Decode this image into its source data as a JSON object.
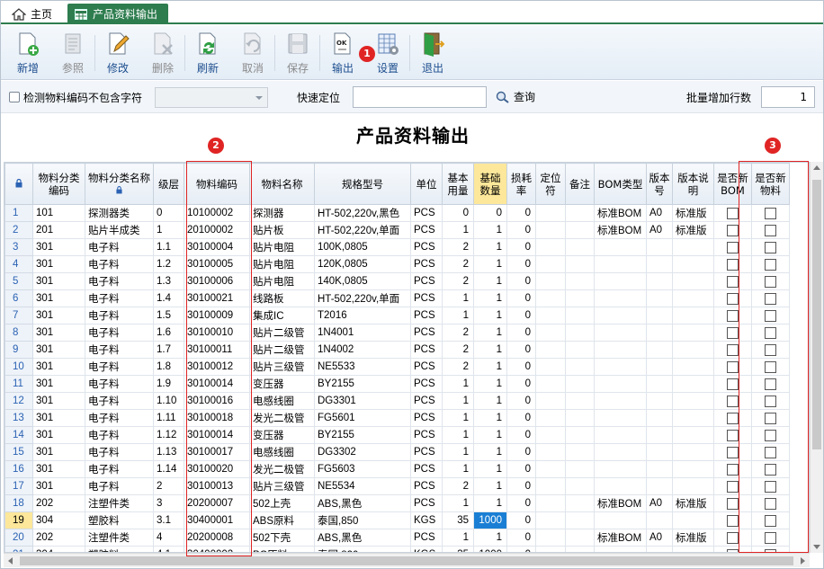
{
  "tabs": [
    {
      "label": "主页",
      "icon": "home-icon"
    },
    {
      "label": "产品资料输出",
      "icon": "table-icon"
    }
  ],
  "toolbar": {
    "buttons": [
      {
        "label": "新增",
        "icon": "new-doc-icon",
        "enabled": true
      },
      {
        "label": "参照",
        "icon": "reference-icon",
        "enabled": false
      },
      {
        "label": "修改",
        "icon": "edit-icon",
        "enabled": true
      },
      {
        "label": "删除",
        "icon": "delete-icon",
        "enabled": false
      },
      {
        "label": "刷新",
        "icon": "refresh-icon",
        "enabled": true
      },
      {
        "label": "取消",
        "icon": "cancel-icon",
        "enabled": false
      },
      {
        "label": "保存",
        "icon": "save-icon",
        "enabled": false
      },
      {
        "label": "输出",
        "icon": "export-icon",
        "enabled": true
      },
      {
        "label": "设置",
        "icon": "settings-icon",
        "enabled": true
      },
      {
        "label": "退出",
        "icon": "exit-icon",
        "enabled": true
      }
    ]
  },
  "filter": {
    "checkbox_label": "检测物料编码不包含字符",
    "quick_locate_label": "快速定位",
    "quick_locate_value": "",
    "query_label": "查询",
    "batch_rows_label": "批量增加行数",
    "batch_rows_value": "1"
  },
  "page_title": "产品资料输出",
  "annotations": [
    "1",
    "2",
    "3"
  ],
  "colors": {
    "brand_green": "#2e7d4f",
    "highlight_yellow": "#fce79a",
    "selected_blue": "#1a7fd4",
    "annotation_red": "#e02424"
  },
  "grid": {
    "columns": [
      "物料分类编码",
      "物料分类名称",
      "级层",
      "物料编码",
      "物料名称",
      "规格型号",
      "单位",
      "基本用量",
      "基础数量",
      "损耗率",
      "定位符",
      "备注",
      "BOM类型",
      "版本号",
      "版本说明",
      "是否新BOM",
      "是否新物料"
    ],
    "rows": [
      {
        "n": "1",
        "cat": "101",
        "catname": "探测器类",
        "lvl": "0",
        "code": "10100002",
        "name": "探测器",
        "spec": "HT-502,220v,黑色",
        "unit": "PCS",
        "use": "0",
        "qty": "0",
        "loss": "0",
        "bom": "标准BOM",
        "ver": "A0",
        "verdesc": "标准版"
      },
      {
        "n": "2",
        "cat": "201",
        "catname": "贴片半成类",
        "lvl": "1",
        "code": "20100002",
        "name": "贴片板",
        "spec": "HT-502,220v,单面",
        "unit": "PCS",
        "use": "1",
        "qty": "1",
        "loss": "0",
        "bom": "标准BOM",
        "ver": "A0",
        "verdesc": "标准版"
      },
      {
        "n": "3",
        "cat": "301",
        "catname": "电子料",
        "lvl": "1.1",
        "code": "30100004",
        "name": "贴片电阻",
        "spec": "100K,0805",
        "unit": "PCS",
        "use": "2",
        "qty": "1",
        "loss": "0",
        "bom": "",
        "ver": "",
        "verdesc": ""
      },
      {
        "n": "4",
        "cat": "301",
        "catname": "电子料",
        "lvl": "1.2",
        "code": "30100005",
        "name": "贴片电阻",
        "spec": "120K,0805",
        "unit": "PCS",
        "use": "2",
        "qty": "1",
        "loss": "0",
        "bom": "",
        "ver": "",
        "verdesc": ""
      },
      {
        "n": "5",
        "cat": "301",
        "catname": "电子料",
        "lvl": "1.3",
        "code": "30100006",
        "name": "贴片电阻",
        "spec": "140K,0805",
        "unit": "PCS",
        "use": "2",
        "qty": "1",
        "loss": "0",
        "bom": "",
        "ver": "",
        "verdesc": ""
      },
      {
        "n": "6",
        "cat": "301",
        "catname": "电子料",
        "lvl": "1.4",
        "code": "30100021",
        "name": "线路板",
        "spec": "HT-502,220v,单面",
        "unit": "PCS",
        "use": "1",
        "qty": "1",
        "loss": "0",
        "bom": "",
        "ver": "",
        "verdesc": ""
      },
      {
        "n": "7",
        "cat": "301",
        "catname": "电子料",
        "lvl": "1.5",
        "code": "30100009",
        "name": "集成IC",
        "spec": "T2016",
        "unit": "PCS",
        "use": "1",
        "qty": "1",
        "loss": "0",
        "bom": "",
        "ver": "",
        "verdesc": ""
      },
      {
        "n": "8",
        "cat": "301",
        "catname": "电子料",
        "lvl": "1.6",
        "code": "30100010",
        "name": "贴片二级管",
        "spec": "1N4001",
        "unit": "PCS",
        "use": "2",
        "qty": "1",
        "loss": "0",
        "bom": "",
        "ver": "",
        "verdesc": ""
      },
      {
        "n": "9",
        "cat": "301",
        "catname": "电子料",
        "lvl": "1.7",
        "code": "30100011",
        "name": "贴片二级管",
        "spec": "1N4002",
        "unit": "PCS",
        "use": "2",
        "qty": "1",
        "loss": "0",
        "bom": "",
        "ver": "",
        "verdesc": ""
      },
      {
        "n": "10",
        "cat": "301",
        "catname": "电子料",
        "lvl": "1.8",
        "code": "30100012",
        "name": "贴片三级管",
        "spec": "NE5533",
        "unit": "PCS",
        "use": "2",
        "qty": "1",
        "loss": "0",
        "bom": "",
        "ver": "",
        "verdesc": ""
      },
      {
        "n": "11",
        "cat": "301",
        "catname": "电子料",
        "lvl": "1.9",
        "code": "30100014",
        "name": "变压器",
        "spec": "BY2155",
        "unit": "PCS",
        "use": "1",
        "qty": "1",
        "loss": "0",
        "bom": "",
        "ver": "",
        "verdesc": ""
      },
      {
        "n": "12",
        "cat": "301",
        "catname": "电子料",
        "lvl": "1.10",
        "code": "30100016",
        "name": "电感线圈",
        "spec": "DG3301",
        "unit": "PCS",
        "use": "1",
        "qty": "1",
        "loss": "0",
        "bom": "",
        "ver": "",
        "verdesc": ""
      },
      {
        "n": "13",
        "cat": "301",
        "catname": "电子料",
        "lvl": "1.11",
        "code": "30100018",
        "name": "发光二极管",
        "spec": "FG5601",
        "unit": "PCS",
        "use": "1",
        "qty": "1",
        "loss": "0",
        "bom": "",
        "ver": "",
        "verdesc": ""
      },
      {
        "n": "14",
        "cat": "301",
        "catname": "电子料",
        "lvl": "1.12",
        "code": "30100014",
        "name": "变压器",
        "spec": "BY2155",
        "unit": "PCS",
        "use": "1",
        "qty": "1",
        "loss": "0",
        "bom": "",
        "ver": "",
        "verdesc": ""
      },
      {
        "n": "15",
        "cat": "301",
        "catname": "电子料",
        "lvl": "1.13",
        "code": "30100017",
        "name": "电感线圈",
        "spec": "DG3302",
        "unit": "PCS",
        "use": "1",
        "qty": "1",
        "loss": "0",
        "bom": "",
        "ver": "",
        "verdesc": ""
      },
      {
        "n": "16",
        "cat": "301",
        "catname": "电子料",
        "lvl": "1.14",
        "code": "30100020",
        "name": "发光二极管",
        "spec": "FG5603",
        "unit": "PCS",
        "use": "1",
        "qty": "1",
        "loss": "0",
        "bom": "",
        "ver": "",
        "verdesc": ""
      },
      {
        "n": "17",
        "cat": "301",
        "catname": "电子料",
        "lvl": "2",
        "code": "30100013",
        "name": "贴片三级管",
        "spec": "NE5534",
        "unit": "PCS",
        "use": "2",
        "qty": "1",
        "loss": "0",
        "bom": "",
        "ver": "",
        "verdesc": ""
      },
      {
        "n": "18",
        "cat": "202",
        "catname": "注塑件类",
        "lvl": "3",
        "code": "20200007",
        "name": "502上壳",
        "spec": "ABS,黑色",
        "unit": "PCS",
        "use": "1",
        "qty": "1",
        "loss": "0",
        "bom": "标准BOM",
        "ver": "A0",
        "verdesc": "标准版"
      },
      {
        "n": "19",
        "cat": "304",
        "catname": "塑胶料",
        "lvl": "3.1",
        "code": "30400001",
        "name": "ABS原料",
        "spec": "泰国,850",
        "unit": "KGS",
        "use": "35",
        "qty": "1000",
        "loss": "0",
        "bom": "",
        "ver": "",
        "verdesc": ""
      },
      {
        "n": "20",
        "cat": "202",
        "catname": "注塑件类",
        "lvl": "4",
        "code": "20200008",
        "name": "502下壳",
        "spec": "ABS,黑色",
        "unit": "PCS",
        "use": "1",
        "qty": "1",
        "loss": "0",
        "bom": "标准BOM",
        "ver": "A0",
        "verdesc": "标准版"
      },
      {
        "n": "21",
        "cat": "304",
        "catname": "塑胶料",
        "lvl": "4.1",
        "code": "30400002",
        "name": "PC原料",
        "spec": "泰国,820",
        "unit": "KGS",
        "use": "35",
        "qty": "1000",
        "loss": "0",
        "bom": "",
        "ver": "",
        "verdesc": ""
      }
    ]
  }
}
